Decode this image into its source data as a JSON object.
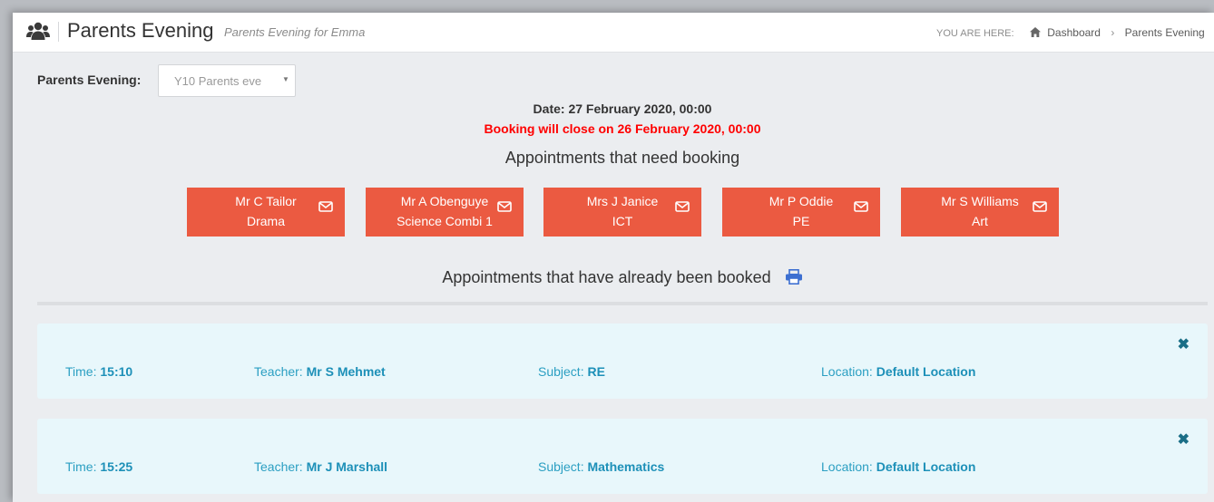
{
  "header": {
    "title": "Parents Evening",
    "subtitle": "Parents Evening for Emma",
    "breadcrumb": {
      "prefix": "YOU ARE HERE:",
      "home": "Dashboard",
      "current": "Parents Evening"
    }
  },
  "selector": {
    "label": "Parents Evening:",
    "value": "Y10 Parents eve"
  },
  "info": {
    "date": "Date: 27 February 2020, 00:00",
    "closing": "Booking will close on 26 February 2020, 00:00",
    "closing_color": "#ff0000"
  },
  "need_booking": {
    "heading": "Appointments that need booking",
    "button_color": "#eb5a41",
    "teachers": [
      {
        "name": "Mr C Tailor",
        "subject": "Drama"
      },
      {
        "name": "Mr A Obenguye",
        "subject": "Science Combi 1"
      },
      {
        "name": "Mrs J Janice",
        "subject": "ICT"
      },
      {
        "name": "Mr P Oddie",
        "subject": "PE"
      },
      {
        "name": "Mr S Williams",
        "subject": "Art"
      }
    ]
  },
  "booked": {
    "heading": "Appointments that have already been booked",
    "labels": {
      "time": "Time:",
      "teacher": "Teacher:",
      "subject": "Subject:",
      "location": "Location:"
    },
    "rows": [
      {
        "time": "15:10",
        "teacher": "Mr S Mehmet",
        "subject": "RE",
        "location": "Default Location"
      },
      {
        "time": "15:25",
        "teacher": "Mr J Marshall",
        "subject": "Mathematics",
        "location": "Default Location"
      }
    ]
  },
  "icons": {
    "header": "users-icon",
    "breadcrumb": "home-icon",
    "teacher_button": "envelope-icon",
    "booked_heading": "print-icon",
    "remove": "close-icon"
  }
}
